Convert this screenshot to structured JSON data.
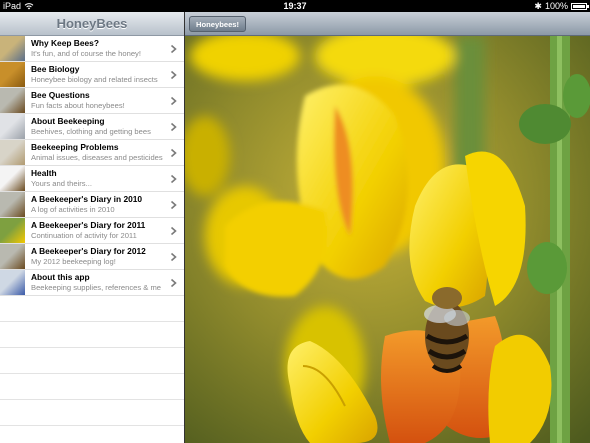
{
  "status_bar": {
    "device": "iPad",
    "time": "19:37",
    "battery": "100%",
    "battery_level": 1.0,
    "icons": [
      "wifi-icon",
      "bluetooth-icon",
      "battery-icon"
    ]
  },
  "master": {
    "title": "HoneyBees",
    "items": [
      {
        "title": "Why Keep Bees?",
        "subtitle": "It's fun, and of course the honey!",
        "thumb": "bee-keepers-photo"
      },
      {
        "title": "Bee Biology",
        "subtitle": "Honeybee biology and related insects",
        "thumb": "honeycomb-photo"
      },
      {
        "title": "Bee Questions",
        "subtitle": "Fun facts about honeybees!",
        "thumb": "bee-photo"
      },
      {
        "title": "About Beekeeping",
        "subtitle": "Beehives, clothing and getting bees",
        "thumb": "beekeeper-photo"
      },
      {
        "title": "Beekeeping Problems",
        "subtitle": "Animal issues, diseases and pesticides",
        "thumb": "hives-photo"
      },
      {
        "title": "Health",
        "subtitle": "Yours and theirs...",
        "thumb": "bee-icon-photo"
      },
      {
        "title": "A Beekeeper's Diary in 2010",
        "subtitle": "A log of activities in 2010",
        "thumb": "bee-photo"
      },
      {
        "title": "A Beekeeper's Diary for 2011",
        "subtitle": "Continuation of activity for 2011",
        "thumb": "flower-photo"
      },
      {
        "title": "A Beekeeper's Diary for 2012",
        "subtitle": "My 2012 beekeeping log!",
        "thumb": "bee-photo"
      },
      {
        "title": "About this app",
        "subtitle": "Beekeeping supplies, references & me",
        "thumb": "jar-photo"
      }
    ]
  },
  "detail": {
    "button_label": "Honeybees!"
  },
  "colors": {
    "nav_gradient_top": "#e6eaee",
    "nav_title": "#6d7884",
    "subtitle_gray": "#8a8a8a",
    "flower_yellow": "#f4d000",
    "flower_orange": "#e8701a",
    "stem_green": "#5a9a38"
  }
}
